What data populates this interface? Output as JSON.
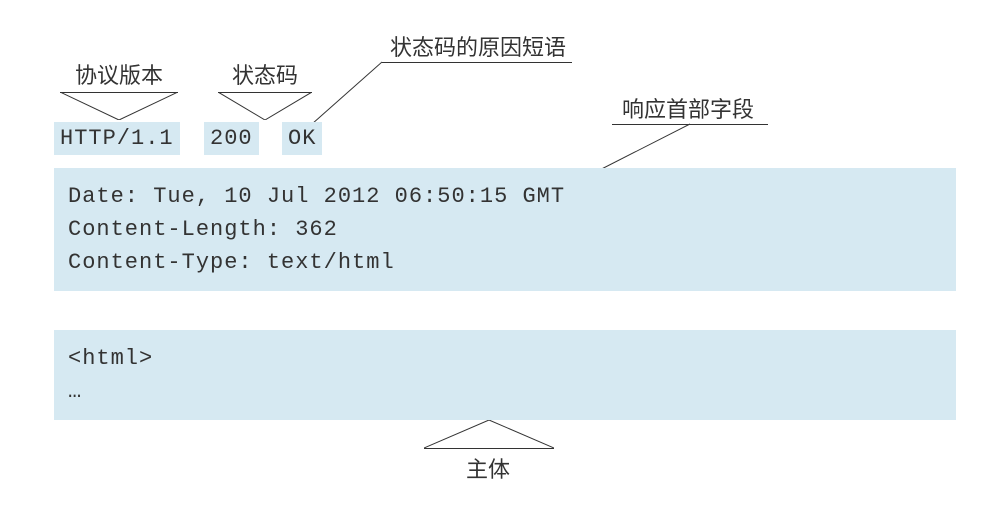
{
  "labels": {
    "protocol": "协议版本",
    "status_code": "状态码",
    "reason_phrase": "状态码的原因短语",
    "response_headers": "响应首部字段",
    "body": "主体"
  },
  "status_line": {
    "protocol": "HTTP/1.1",
    "code": "200",
    "reason": "OK"
  },
  "headers_block": "Date: Tue, 10 Jul 2012 06:50:15 GMT\nContent-Length: 362\nContent-Type: text/html",
  "body_block": "<html>\n…"
}
